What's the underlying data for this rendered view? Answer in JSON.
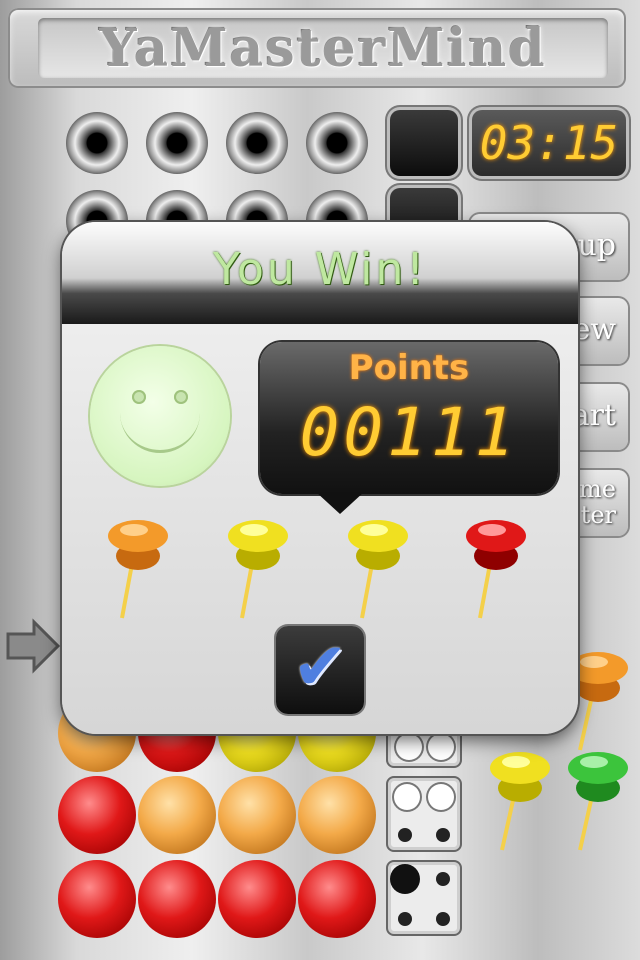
{
  "app": {
    "title": "YaMasterMind"
  },
  "timer": {
    "value": "03:15"
  },
  "side_buttons": [
    {
      "id": "setup",
      "visible_text": "tup"
    },
    {
      "id": "new",
      "visible_text": "ew"
    },
    {
      "id": "restart",
      "visible_text": "art"
    },
    {
      "id": "game-center",
      "visible_text": "me\nter"
    }
  ],
  "dialog": {
    "title": "You Win!",
    "points_label": "Points",
    "points_value": "00111",
    "secret_code": [
      "orange",
      "yellow",
      "yellow",
      "red"
    ],
    "ok_icon": "checkmark-icon"
  },
  "board": {
    "empty_rows": 2,
    "current_row_indicator": "arrow-icon",
    "guess_rows": [
      {
        "pegs": [
          "orange",
          "red",
          "yellow",
          "yellow"
        ],
        "feedback": {
          "black": 0,
          "white": 2
        }
      },
      {
        "pegs": [
          "red",
          "orange",
          "orange",
          "orange"
        ],
        "feedback": {
          "black": 0,
          "white": 2
        }
      },
      {
        "pegs": [
          "red",
          "red",
          "red",
          "red"
        ],
        "feedback": {
          "black": 1,
          "white": 0
        }
      }
    ]
  },
  "palette_pins": [
    "orange",
    "yellow",
    "green"
  ],
  "colors": {
    "red": "#e01818",
    "orange": "#f3a948",
    "yellow": "#f0e020",
    "green": "#3cc43c",
    "digit": "#ffcc33",
    "win_text": "#bfe8a0"
  }
}
